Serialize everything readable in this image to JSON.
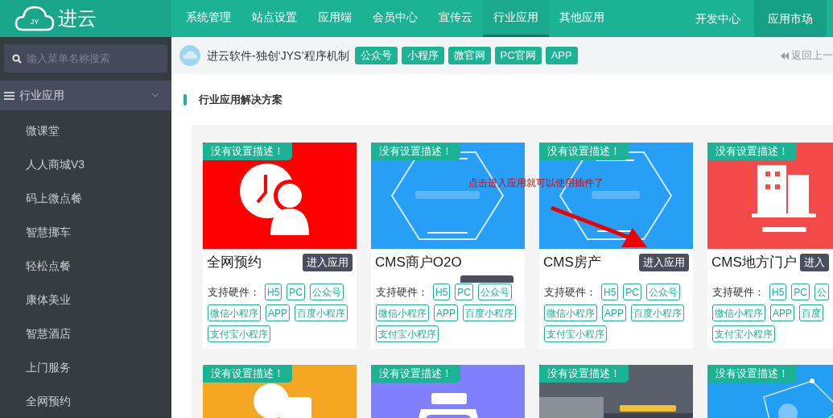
{
  "logo": {
    "mark": "JY",
    "name": "进云"
  },
  "nav": [
    {
      "label": "系统管理",
      "selected": false
    },
    {
      "label": "站点设置",
      "selected": false
    },
    {
      "label": "应用端",
      "selected": false
    },
    {
      "label": "会员中心",
      "selected": false
    },
    {
      "label": "宣传云",
      "selected": false
    },
    {
      "label": "行业应用",
      "selected": true
    },
    {
      "label": "其他应用",
      "selected": false
    }
  ],
  "right_nav": [
    {
      "label": "开发中心",
      "active": false
    },
    {
      "label": "应用市场",
      "active": true
    }
  ],
  "sidebar": {
    "search": {
      "placeholder": "输入菜单名称搜索"
    },
    "group": {
      "label": "行业应用",
      "expanded": true,
      "children": [
        {
          "label": "微课堂"
        },
        {
          "label": "人人商城V3"
        },
        {
          "label": "码上微点餐"
        },
        {
          "label": "智慧挪车"
        },
        {
          "label": "轻松点餐"
        },
        {
          "label": "康体美业"
        },
        {
          "label": "智慧酒店"
        },
        {
          "label": "上门服务"
        },
        {
          "label": "全网预约"
        }
      ]
    }
  },
  "breadcrumb": {
    "text": "进云软件-独创‘JYS’程序机制",
    "tags": [
      "公众号",
      "小程序",
      "微官网",
      "PC官网",
      "APP"
    ],
    "back": "返回上一"
  },
  "section_title": "行业应用解决方案",
  "annotation": {
    "text": "点击进入应用就可以使用插件了"
  },
  "cards": [
    {
      "badge": "没有设置描述！",
      "title": "全网预约",
      "button": "进入应用",
      "hardware_label": "支持硬件：",
      "tags": [
        "H5",
        "PC",
        "公众号",
        "微信小程序",
        "APP",
        "百度小程序",
        "支付宝小程序"
      ]
    },
    {
      "badge": "没有设置描述！",
      "title": "CMS商户O2O",
      "button_covered": true,
      "hardware_label": "支持硬件：",
      "tags": [
        "H5",
        "PC",
        "公众号",
        "微信小程序",
        "APP",
        "百度小程序",
        "支付宝小程序"
      ]
    },
    {
      "badge": "没有设置描述！",
      "title": "CMS房产",
      "button": "进入应用",
      "hardware_label": "支持硬件：",
      "tags": [
        "H5",
        "PC",
        "公众号",
        "微信小程序",
        "APP",
        "百度小程序",
        "支付宝小程序"
      ]
    },
    {
      "badge": "没有设置描述！",
      "title": "CMS地方门户",
      "button": "进入",
      "hardware_label": "支持硬件：",
      "tags": [
        "H5",
        "PC",
        "公",
        "微信小程序",
        "APP",
        "百度",
        "支付宝小程序"
      ]
    },
    {
      "badge": "没有设置描述！"
    },
    {
      "badge": "没有设置描述！"
    },
    {
      "badge": "没有设置描述！"
    },
    {
      "badge": "没有设置描述！"
    }
  ]
}
